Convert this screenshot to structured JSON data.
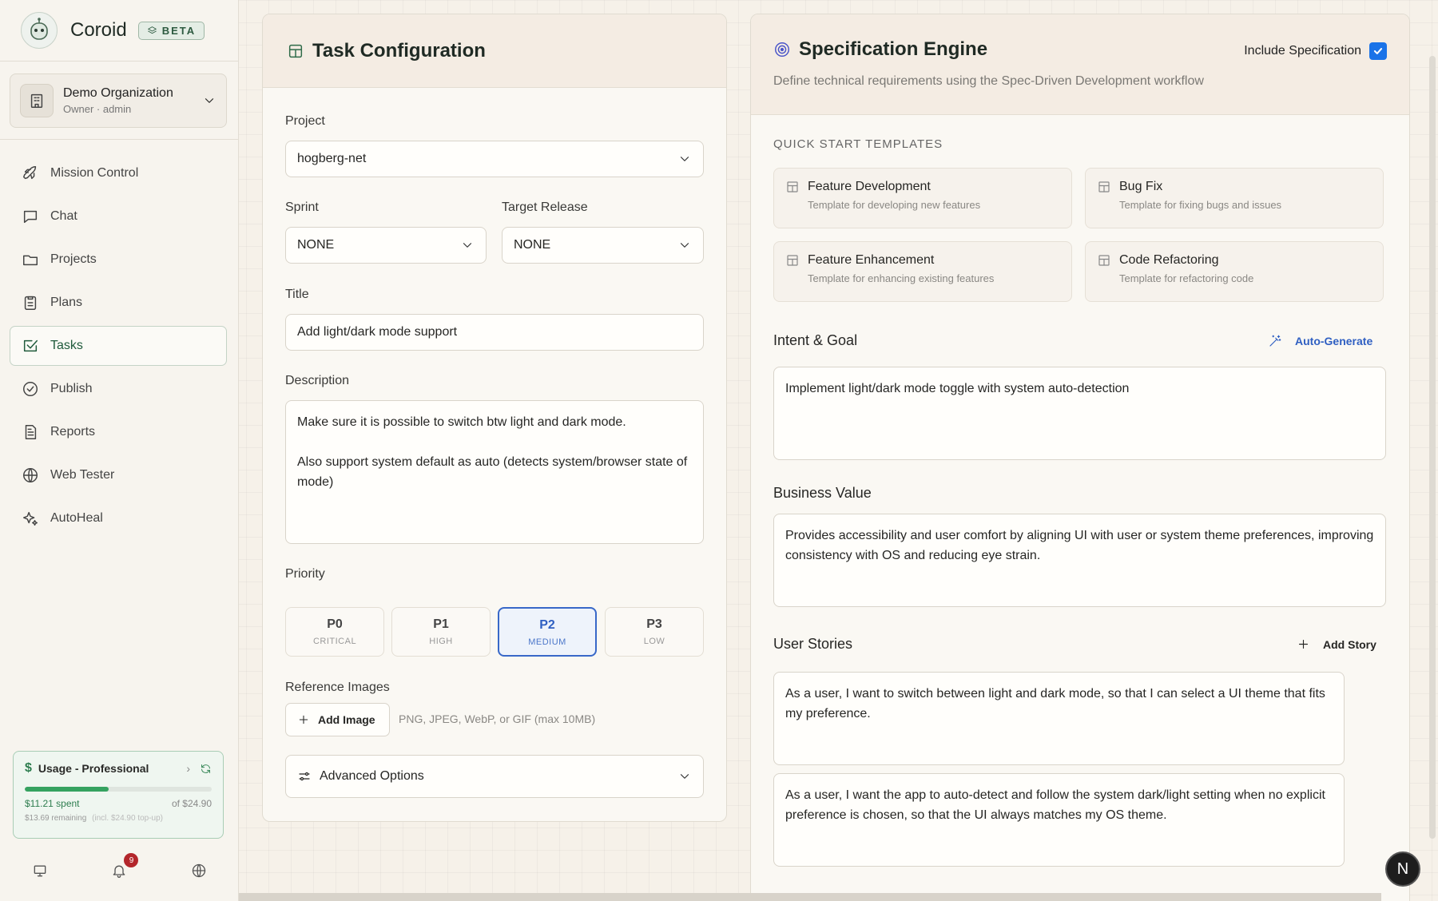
{
  "app": {
    "name": "Coroid",
    "beta_label": "BETA"
  },
  "org": {
    "name": "Demo Organization",
    "role_line": "Owner · admin"
  },
  "nav": [
    {
      "label": "Mission Control",
      "icon": "rocket-icon",
      "active": false
    },
    {
      "label": "Chat",
      "icon": "chat-icon",
      "active": false
    },
    {
      "label": "Projects",
      "icon": "folder-icon",
      "active": false
    },
    {
      "label": "Plans",
      "icon": "clipboard-icon",
      "active": false
    },
    {
      "label": "Tasks",
      "icon": "checkbox-icon",
      "active": true
    },
    {
      "label": "Publish",
      "icon": "check-circle-icon",
      "active": false
    },
    {
      "label": "Reports",
      "icon": "document-icon",
      "active": false
    },
    {
      "label": "Web Tester",
      "icon": "globe-icon",
      "active": false
    },
    {
      "label": "AutoHeal",
      "icon": "sparkles-icon",
      "active": false
    }
  ],
  "usage": {
    "title": "Usage - Professional",
    "spent": "$11.21 spent",
    "of": "of $24.90",
    "remaining": "$13.69 remaining",
    "remaining_note": "(incl. $24.90 top-up)",
    "progress_fraction": 0.45,
    "notification_count": "9"
  },
  "task": {
    "title": "Task Configuration",
    "project_label": "Project",
    "project_value": "hogberg-net",
    "sprint_label": "Sprint",
    "sprint_value": "NONE",
    "release_label": "Target Release",
    "release_value": "NONE",
    "title_label": "Title",
    "title_value": "Add light/dark mode support",
    "description_label": "Description",
    "description_value": "Make sure it is possible to switch btw light and dark mode.\n\nAlso support system default as auto (detects system/browser state of mode)",
    "priority_label": "Priority",
    "priorities": [
      {
        "code": "P0",
        "name": "CRITICAL",
        "selected": false
      },
      {
        "code": "P1",
        "name": "HIGH",
        "selected": false
      },
      {
        "code": "P2",
        "name": "MEDIUM",
        "selected": true
      },
      {
        "code": "P3",
        "name": "LOW",
        "selected": false
      }
    ],
    "ref_images_label": "Reference Images",
    "add_image_label": "Add Image",
    "image_hint": "PNG, JPEG, WebP, or GIF (max 10MB)",
    "advanced_label": "Advanced Options"
  },
  "spec": {
    "title": "Specification Engine",
    "subtitle": "Define technical requirements using the Spec-Driven Development workflow",
    "include_label": "Include Specification",
    "include_checked": true,
    "templates_caption": "QUICK START TEMPLATES",
    "templates": [
      {
        "title": "Feature Development",
        "desc": "Template for developing new features"
      },
      {
        "title": "Bug Fix",
        "desc": "Template for fixing bugs and issues"
      },
      {
        "title": "Feature Enhancement",
        "desc": "Template for enhancing existing features"
      },
      {
        "title": "Code Refactoring",
        "desc": "Template for refactoring code"
      }
    ],
    "intent_label": "Intent & Goal",
    "auto_generate_label": "Auto-Generate",
    "intent_value": "Implement light/dark mode toggle with system auto-detection",
    "business_label": "Business Value",
    "business_value": "Provides accessibility and user comfort by aligning UI with user or system theme preferences, improving consistency with OS and reducing eye strain.",
    "stories_label": "User Stories",
    "add_story_label": "Add Story",
    "stories": [
      "As a user, I want to switch between light and dark mode, so that I can select a UI theme that fits my preference.",
      "As a user, I want the app to auto-detect and follow the system dark/light setting when no explicit preference is chosen, so that the UI always matches my OS theme."
    ]
  },
  "fab_label": "N",
  "colors": {
    "accent_green": "#2e7d4f",
    "select_blue": "#3868c8",
    "link_blue": "#2f5fc2"
  }
}
